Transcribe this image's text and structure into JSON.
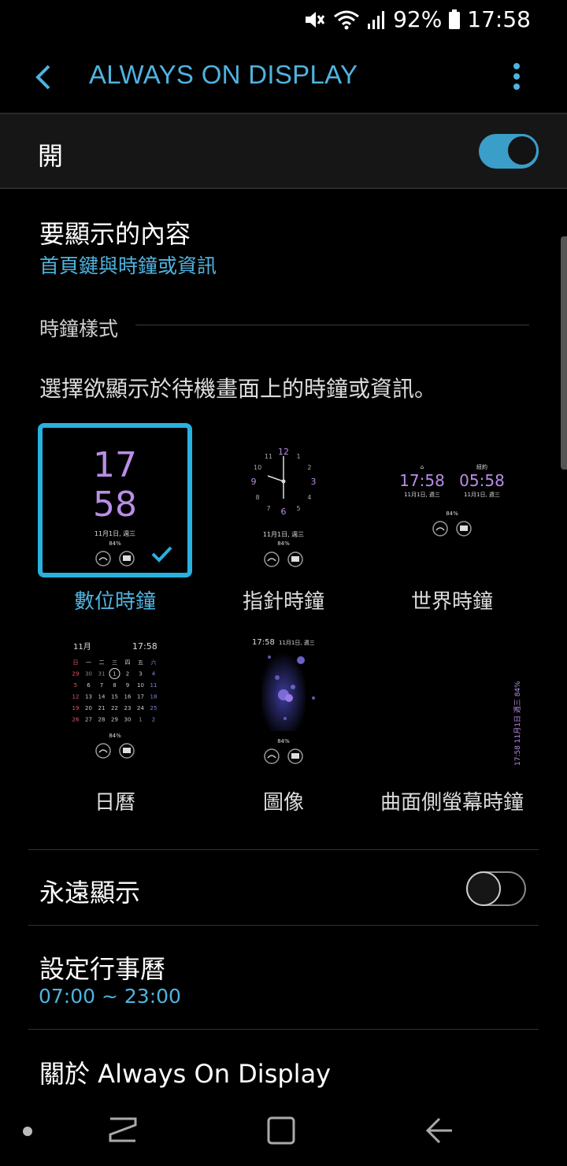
{
  "status": {
    "battery": "92%",
    "time": "17:58"
  },
  "header": {
    "title": "ALWAYS ON DISPLAY"
  },
  "master": {
    "label": "開",
    "on": true
  },
  "content": {
    "title": "要顯示的內容",
    "value": "首頁鍵與時鐘或資訊"
  },
  "clock_style": {
    "section": "時鐘樣式",
    "description": "選擇欲顯示於待機畫面上的時鐘或資訊。",
    "options": [
      {
        "label": "數位時鐘",
        "selected": true
      },
      {
        "label": "指針時鐘",
        "selected": false
      },
      {
        "label": "世界時鐘",
        "selected": false
      },
      {
        "label": "日曆",
        "selected": false
      },
      {
        "label": "圖像",
        "selected": false
      },
      {
        "label": "曲面側螢幕時鐘",
        "selected": false
      }
    ],
    "preview": {
      "digital_hour": "17",
      "digital_min": "58",
      "date": "11月1日, 週三",
      "battery": "84%",
      "world_home_time": "17:58",
      "world_home_date": "11月1日, 週三",
      "world_city": "紐約",
      "world_city_time": "05:58",
      "world_city_date": "11月1日, 週三",
      "calendar_month": "11月",
      "calendar_time": "17:58",
      "calendar_weekdays": [
        "日",
        "一",
        "二",
        "三",
        "四",
        "五",
        "六"
      ],
      "calendar_rows": [
        [
          "29",
          "30",
          "31",
          "1",
          "2",
          "3",
          "4"
        ],
        [
          "5",
          "6",
          "7",
          "8",
          "9",
          "10",
          "11"
        ],
        [
          "12",
          "13",
          "14",
          "15",
          "16",
          "17",
          "18"
        ],
        [
          "19",
          "20",
          "21",
          "22",
          "23",
          "24",
          "25"
        ],
        [
          "26",
          "27",
          "28",
          "29",
          "30",
          "1",
          "2"
        ]
      ],
      "image_time": "17:58",
      "image_date": "11月1日, 週三",
      "edge_text": "17:58  11月1日 週三  84%",
      "analog_numbers": [
        "12",
        "1",
        "2",
        "3",
        "4",
        "5",
        "6",
        "7",
        "8",
        "9",
        "10",
        "11"
      ]
    }
  },
  "always_show": {
    "label": "永遠顯示",
    "on": false
  },
  "schedule": {
    "title": "設定行事曆",
    "value": "07:00 ~ 23:00"
  },
  "about": {
    "title": "關於 Always On Display"
  },
  "colors": {
    "accent": "#4fb3df",
    "selection": "#29b1df",
    "clock_purple": "#b98ee6"
  }
}
